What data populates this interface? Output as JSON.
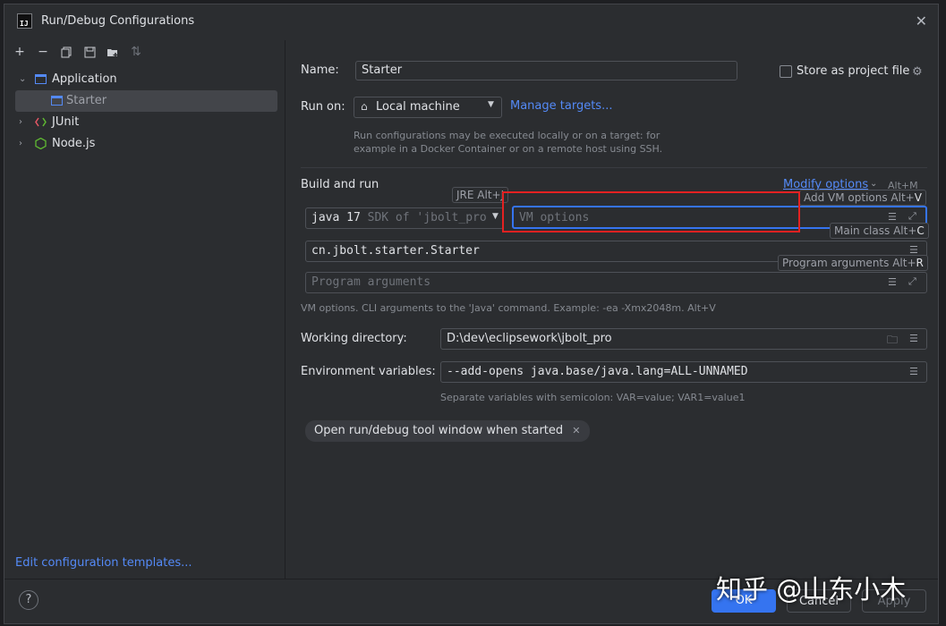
{
  "window": {
    "title": "Run/Debug Configurations",
    "app_icon": "IJ"
  },
  "toolbar": {
    "icons": [
      "plus-icon",
      "minus-icon",
      "copy-icon",
      "save-icon",
      "folder-add-icon",
      "sort-icon"
    ]
  },
  "tree": {
    "application": "Application",
    "starter": "Starter",
    "junit": "JUnit",
    "nodejs": "Node.js"
  },
  "edit_templates": "Edit configuration templates...",
  "form": {
    "name_label": "Name:",
    "name_value": "Starter",
    "store_label": "Store as project file",
    "runon_label": "Run on:",
    "runon_value": "Local machine",
    "manage_targets": "Manage targets...",
    "runon_hint_1": "Run configurations may be executed locally or on a target: for",
    "runon_hint_2": "example in a Docker Container or on a remote host using SSH.",
    "build_run": "Build and run",
    "modify_options": "Modify options",
    "modify_shortcut": "Alt+M",
    "jre_value": "java 17",
    "jre_sdk": "SDK of 'jbolt_pro",
    "vm_placeholder": "VM options",
    "main_class": "cn.jbolt.starter.Starter",
    "program_args_placeholder": "Program arguments",
    "vm_hint": "VM options. CLI arguments to the 'Java' command. Example: -ea -Xmx2048m. Alt+V",
    "workdir_label": "Working directory:",
    "workdir_value": "D:\\dev\\eclipsework\\jbolt_pro",
    "env_label": "Environment variables:",
    "env_value": "--add-opens java.base/java.lang=ALL-UNNAMED",
    "env_hint": "Separate variables with semicolon: VAR=value; VAR1=value1",
    "chip_label": "Open run/debug tool window when started"
  },
  "popups": {
    "jre": "JRE Alt+J",
    "add_vm": "Add VM options Alt+",
    "add_vm_key": "V",
    "main_class": "Main class Alt+",
    "main_class_key": "C",
    "program_args": "Program arguments Alt+",
    "program_args_key": "R"
  },
  "footer": {
    "help": "?",
    "ok": "OK",
    "cancel": "Cancel",
    "apply": "Apply"
  },
  "watermark": "知乎 @山东小木",
  "colors": {
    "accent": "#548af7",
    "primary_button": "#3574f0",
    "highlight_box": "#e32121"
  }
}
